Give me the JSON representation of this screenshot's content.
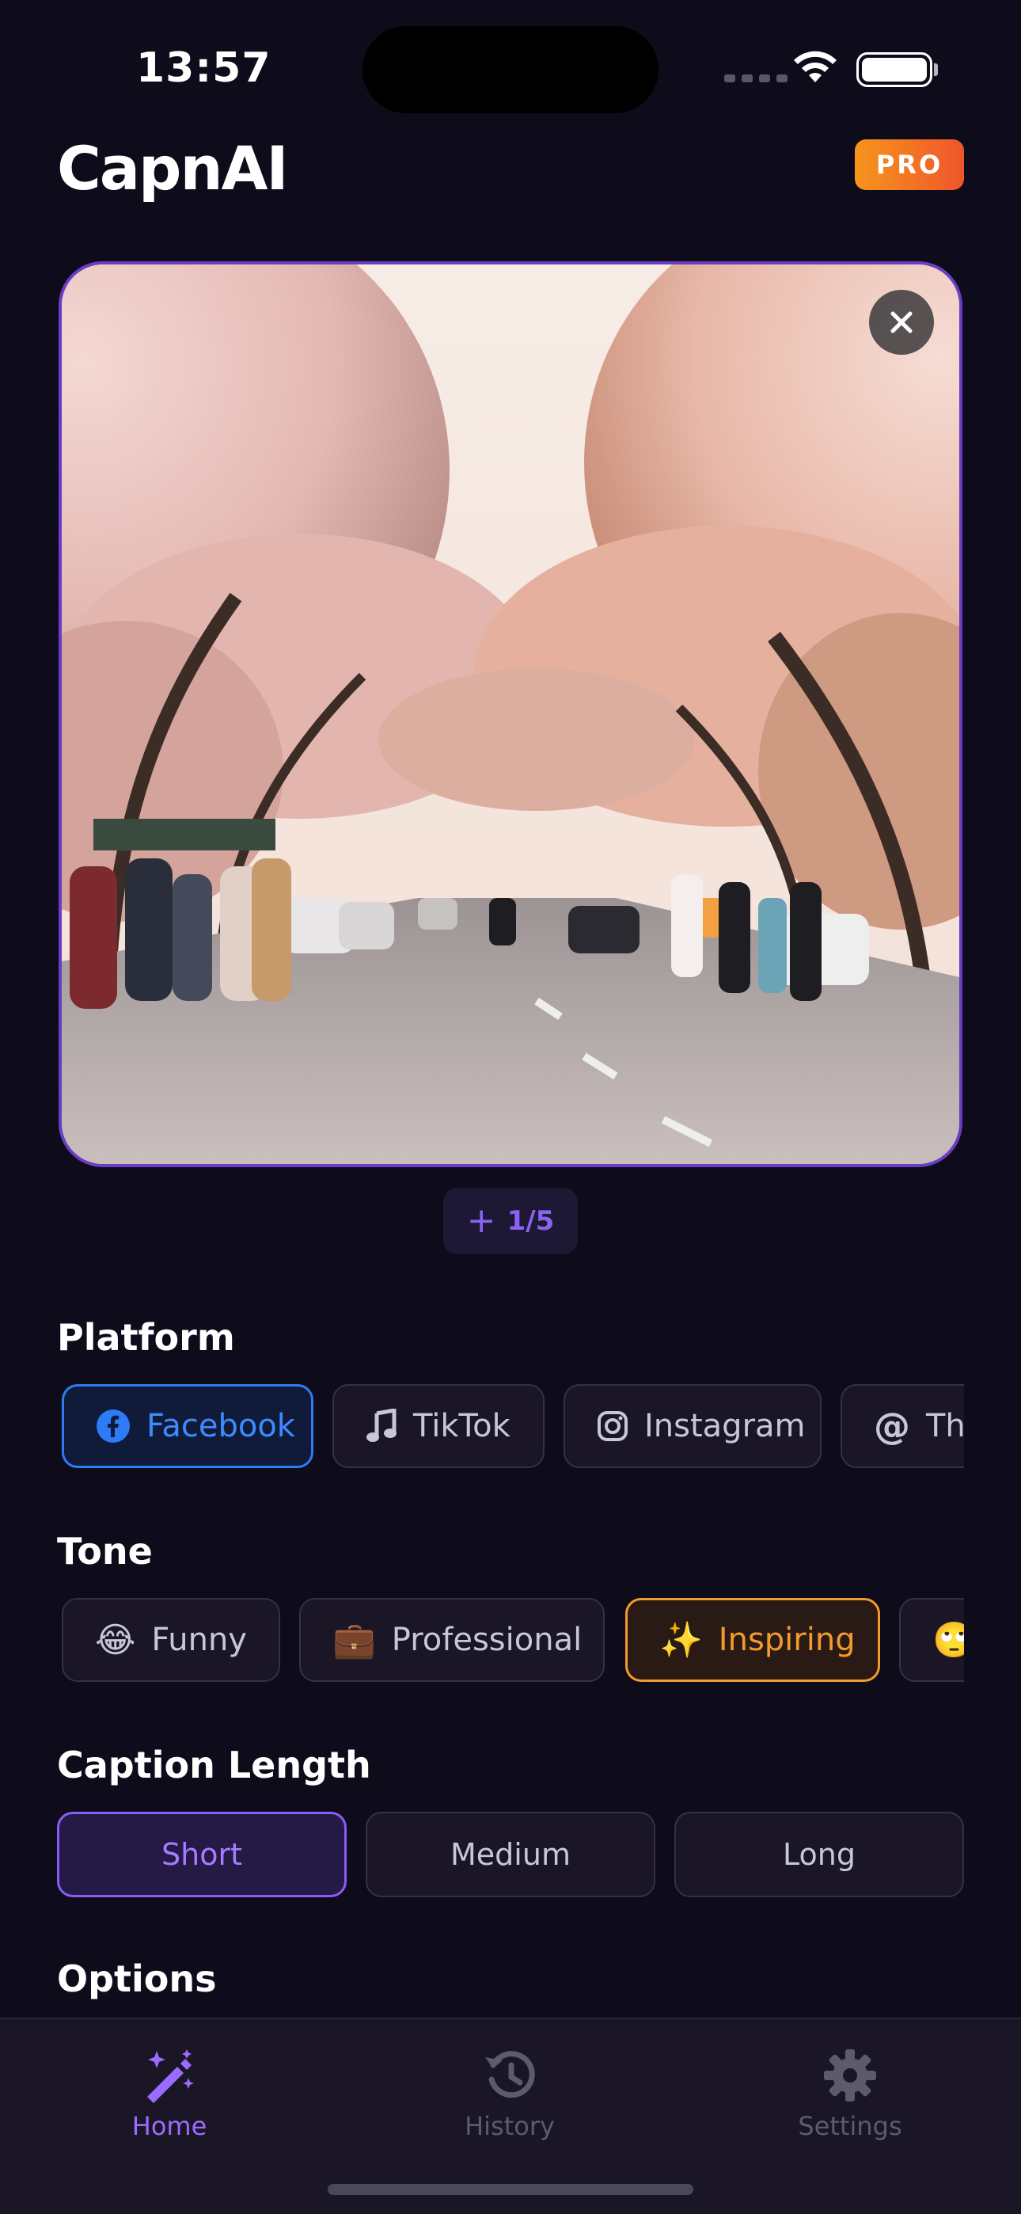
{
  "status": {
    "time": "13:57"
  },
  "header": {
    "app_name": "CapnAI",
    "badge": "PRO"
  },
  "photo": {
    "counter": "1/5"
  },
  "platform": {
    "title": "Platform",
    "items": [
      {
        "label": "Facebook",
        "icon": "facebook-icon",
        "selected": true
      },
      {
        "label": "TikTok",
        "icon": "music-note-icon",
        "selected": false
      },
      {
        "label": "Instagram",
        "icon": "instagram-icon",
        "selected": false
      },
      {
        "label": "Threads",
        "icon": "at-sign-icon",
        "selected": false
      }
    ]
  },
  "tone": {
    "title": "Tone",
    "items": [
      {
        "label": "Funny",
        "emoji": "😂",
        "selected": false
      },
      {
        "label": "Professional",
        "emoji": "💼",
        "selected": false
      },
      {
        "label": "Inspiring",
        "emoji": "✨",
        "selected": true
      },
      {
        "label": "",
        "emoji": "🙄",
        "selected": false
      }
    ]
  },
  "caption_length": {
    "title": "Caption Length",
    "options": [
      {
        "label": "Short",
        "selected": true
      },
      {
        "label": "Medium",
        "selected": false
      },
      {
        "label": "Long",
        "selected": false
      }
    ]
  },
  "options": {
    "title": "Options"
  },
  "tabs": [
    {
      "label": "Home",
      "icon": "magic-wand-icon",
      "active": true
    },
    {
      "label": "History",
      "icon": "history-icon",
      "active": false
    },
    {
      "label": "Settings",
      "icon": "gear-icon",
      "active": false
    }
  ],
  "colors": {
    "background": "#0e0b1a",
    "accent_purple": "#8b5cf6",
    "facebook_blue": "#2d7bf5",
    "tone_orange": "#f39a2b"
  }
}
